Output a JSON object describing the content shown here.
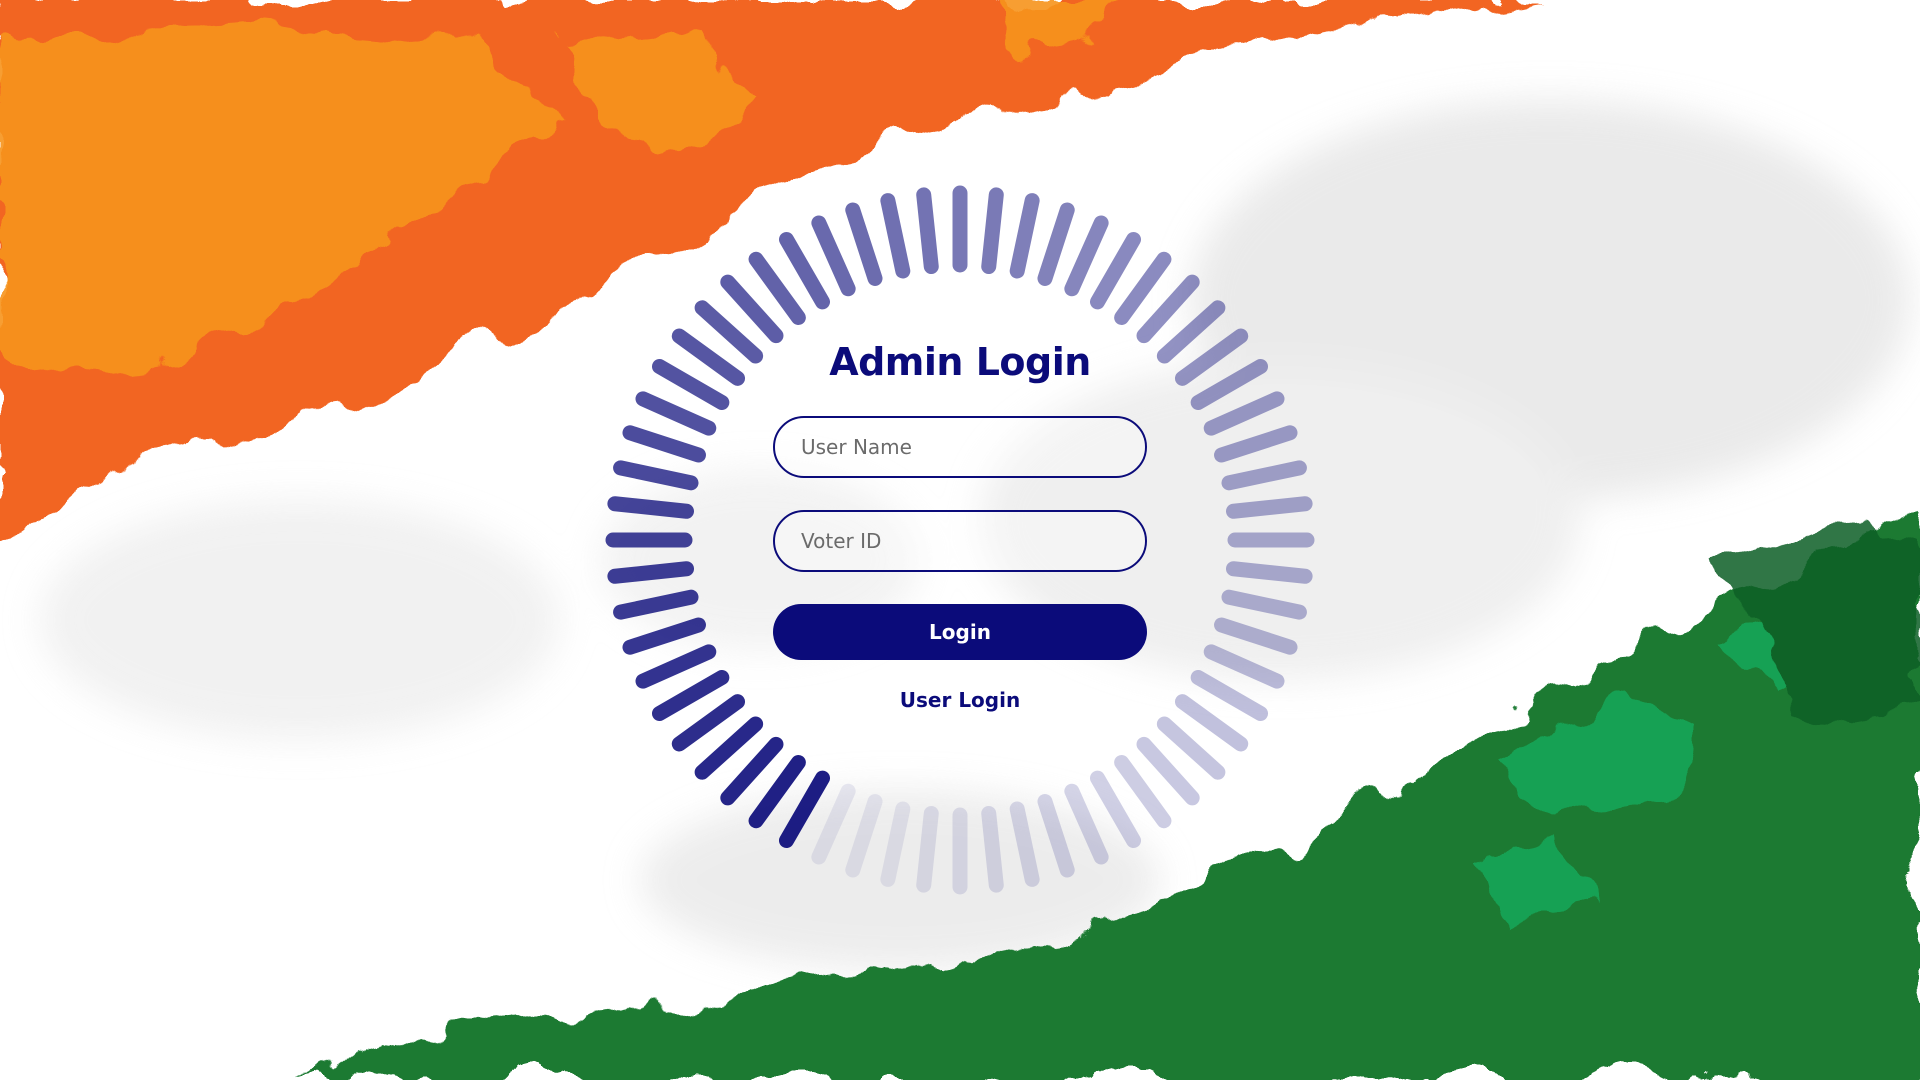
{
  "login": {
    "title": "Admin Login",
    "username_placeholder": "User Name",
    "voter_id_placeholder": "Voter ID",
    "username_value": "",
    "voter_id_value": "",
    "login_button_label": "Login",
    "user_login_link": "User Login"
  },
  "colors": {
    "primary": "#0b0b7a",
    "saffron": "#f26522",
    "saffron_light": "#f7941d",
    "green": "#1a7a32",
    "green_light": "#17a85a",
    "white": "#ffffff"
  },
  "icons": {
    "loading_ring": "radial-spinner-icon"
  }
}
